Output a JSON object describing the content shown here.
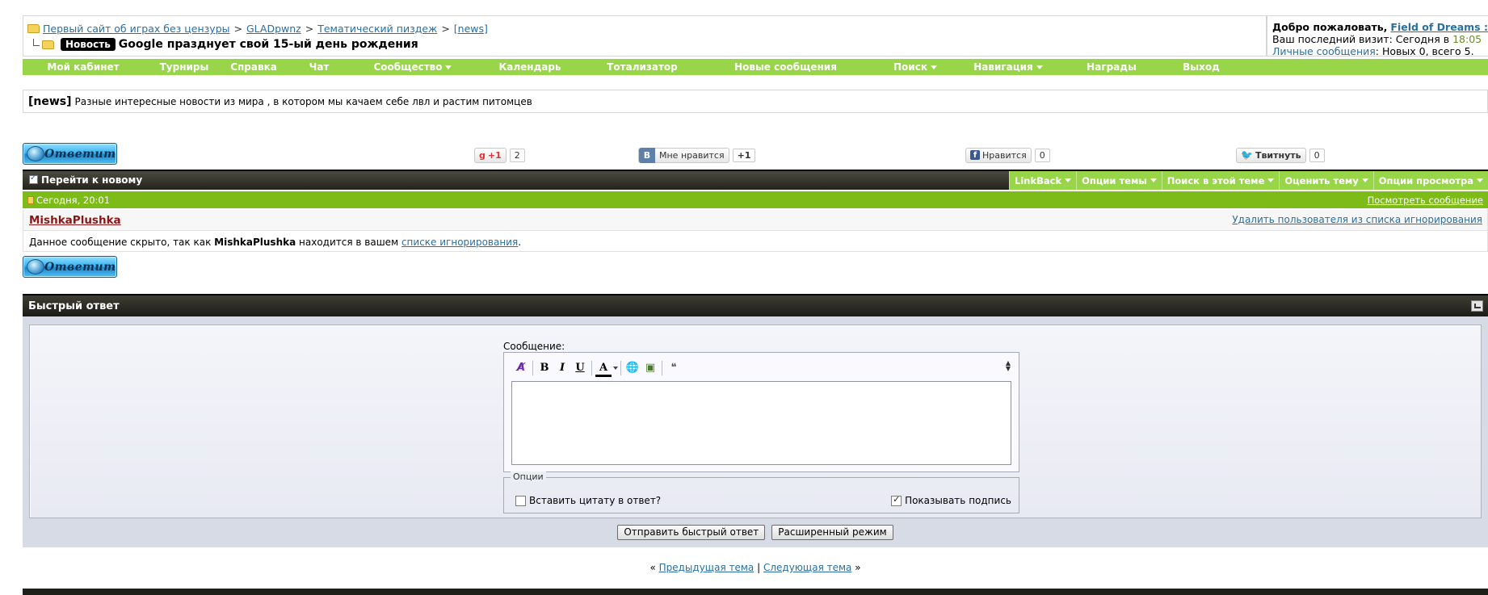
{
  "breadcrumb": {
    "items": [
      "Первый сайт об играх без цензуры",
      "GLADpwnz",
      "Тематический пиздеж",
      "[news]"
    ],
    "separator": ">"
  },
  "thread": {
    "prefix": "Новость",
    "title": "Google празднует свой 15-ый день рождения"
  },
  "welcome": {
    "greeting": "Добро пожаловать,",
    "username": "Field of Dreams :D",
    "greeting_end": ".",
    "last_visit_label": "Ваш последний визит: Сегодня в",
    "last_visit_time": "18:05",
    "pm_link": "Личные сообщения",
    "pm_status": ": Новых 0, всего 5."
  },
  "topnav": {
    "items": [
      {
        "label": "Мой кабинет",
        "dropdown": false
      },
      {
        "label": "Турниры",
        "dropdown": false
      },
      {
        "label": "Справка",
        "dropdown": false
      },
      {
        "label": "Чат",
        "dropdown": false
      },
      {
        "label": "Сообщество",
        "dropdown": true
      },
      {
        "label": "Календарь",
        "dropdown": false
      },
      {
        "label": "Тотализатор",
        "dropdown": false
      },
      {
        "label": "Новые сообщения",
        "dropdown": false
      },
      {
        "label": "Поиск",
        "dropdown": true
      },
      {
        "label": "Навигация",
        "dropdown": true
      },
      {
        "label": "Награды",
        "dropdown": false
      },
      {
        "label": "Выход",
        "dropdown": false
      }
    ]
  },
  "forum": {
    "tag": "[news]",
    "description": "Разные интересные новости из мира , в котором мы качаем себе лвл и растим питомцев"
  },
  "reply_button": {
    "label": "Ответить"
  },
  "social": {
    "gplus": {
      "label": "+1",
      "count": "2"
    },
    "vk": {
      "icon_label": "B",
      "label": "Мне нравится",
      "count": "+1"
    },
    "fb": {
      "label": "Нравится",
      "count": "0"
    },
    "tw": {
      "label": "Твитнуть",
      "count": "0"
    }
  },
  "thread_bar": {
    "goto_new": "Перейти к новому",
    "tools": [
      "LinkBack",
      "Опции темы",
      "Поиск в этой теме",
      "Оценить тему",
      "Опции просмотра"
    ]
  },
  "post": {
    "date": "Сегодня, 20:01",
    "view_link": "Посмотреть сообщение",
    "username": "MishkaPlushka",
    "unignore_link": "Удалить пользователя из списка игнорирования",
    "hidden_text_1": "Данное сообщение скрыто, так как",
    "hidden_user": "MishkaPlushka",
    "hidden_text_2": "находится в вашем",
    "ignore_link": "списке игнорирования",
    "hidden_text_3": "."
  },
  "quick_reply": {
    "title": "Быстрый ответ",
    "message_label": "Сообщение:",
    "message_value": "",
    "toolbar": {
      "bold": "B",
      "italic": "I",
      "underline": "U",
      "color": "A"
    },
    "options_legend": "Опции",
    "quote_option": "Вставить цитату в ответ?",
    "quote_checked": false,
    "signature_option": "Показывать подпись",
    "signature_checked": true,
    "submit_label": "Отправить быстрый ответ",
    "advanced_label": "Расширенный режим"
  },
  "thread_nav": {
    "left_quote": "«",
    "prev": "Предыдущая тема",
    "divider": "|",
    "next": "Следующая тема",
    "right_quote": "»"
  }
}
